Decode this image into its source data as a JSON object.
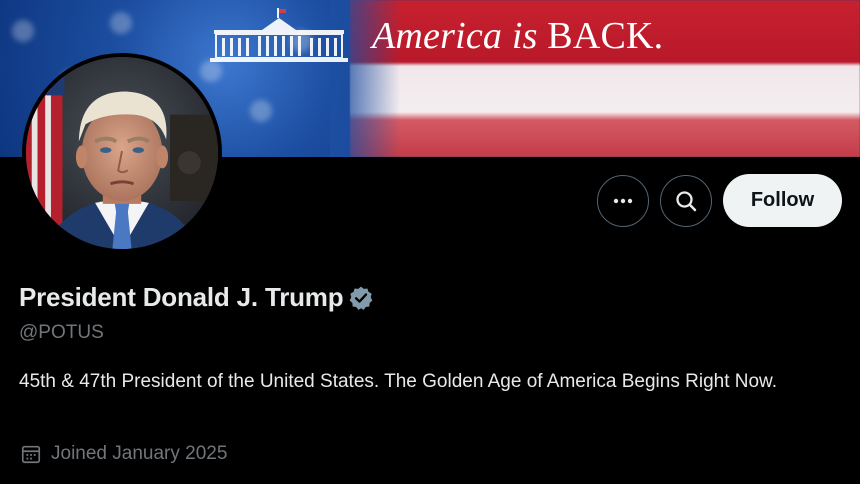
{
  "banner": {
    "text_italic": "America is ",
    "text_caps": "BACK.",
    "icon": "white-house-icon"
  },
  "profile": {
    "avatar": "profile-photo",
    "display_name": "President Donald J. Trump",
    "verified_icon": "verified-badge-icon",
    "handle": "@POTUS",
    "bio": "45th & 47th President of the United States. The Golden Age of America Begins Right Now.",
    "joined_icon": "calendar-icon",
    "joined": "Joined January 2025"
  },
  "actions": {
    "more_icon": "more-options-icon",
    "search_icon": "search-icon",
    "follow_label": "Follow"
  },
  "colors": {
    "background": "#000000",
    "text_primary": "#e7e9ea",
    "text_secondary": "#71767b",
    "follow_bg": "#eff3f4",
    "button_border": "#536471",
    "verified": "#829aab"
  }
}
